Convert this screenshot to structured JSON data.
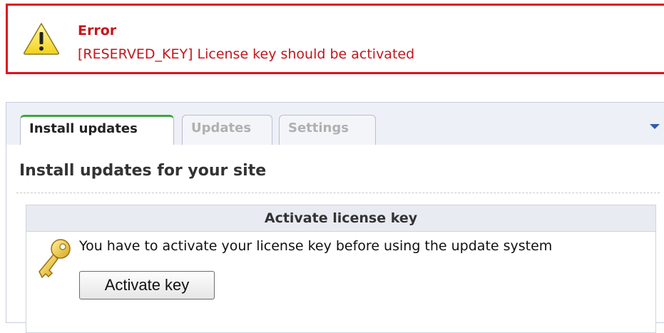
{
  "error": {
    "title": "Error",
    "message": "[RESERVED_KEY] License key should be activated",
    "icon": "warning-icon",
    "color": "#c4161c",
    "border_color": "#e01020"
  },
  "tabs": [
    {
      "label": "Install updates",
      "active": true
    },
    {
      "label": "Updates",
      "active": false
    },
    {
      "label": "Settings",
      "active": false
    }
  ],
  "tab_menu": {
    "icon": "caret-down-icon"
  },
  "main": {
    "page_title": "Install updates for your site",
    "license_box": {
      "header": "Activate license key",
      "icon": "key-icon",
      "message": "You have to activate your license key before using the update system",
      "button_label": "Activate key"
    }
  },
  "colors": {
    "active_tab_accent": "#3ca83c",
    "panel_background": "#eef0f7",
    "link_blue": "#2b5db0"
  }
}
